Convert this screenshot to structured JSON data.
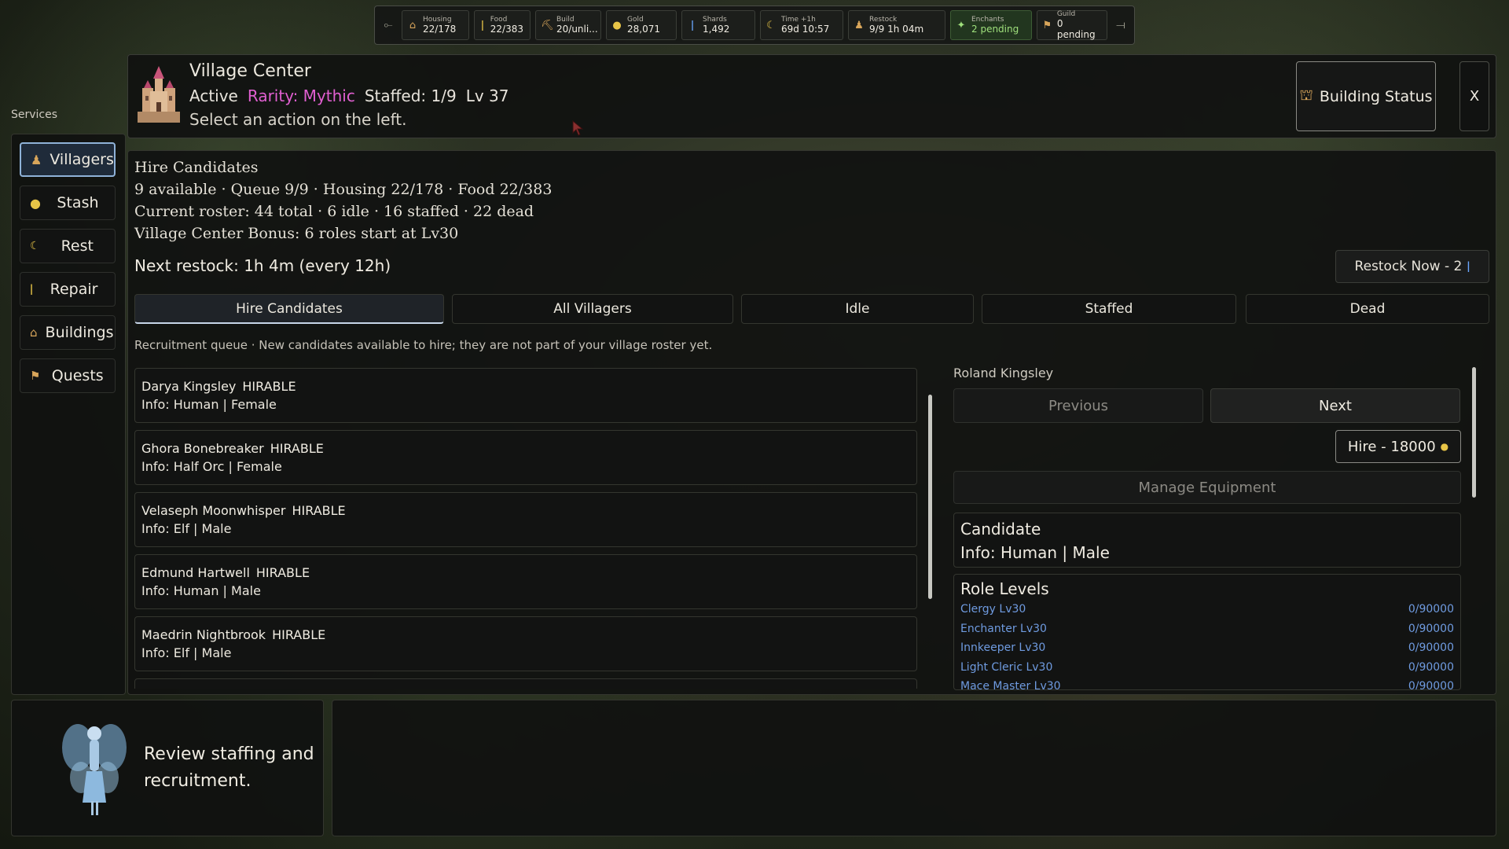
{
  "resources": [
    {
      "label": "Housing",
      "value": "22/178",
      "icon": "housing-icon"
    },
    {
      "label": "Food",
      "value": "22/383",
      "icon": "food-icon"
    },
    {
      "label": "Build",
      "value": "20/unli...",
      "icon": "build-icon"
    },
    {
      "label": "Gold",
      "value": "28,071",
      "icon": "gold-coin-icon"
    },
    {
      "label": "Shards",
      "value": "1,492",
      "icon": "shard-icon"
    },
    {
      "label": "Time +1h",
      "value": "69d 10:57",
      "icon": "moon-icon"
    },
    {
      "label": "Restock",
      "value": "9/9 1h 04m",
      "icon": "restock-icon"
    },
    {
      "label": "Enchants",
      "value": "2 pending",
      "icon": "enchant-icon"
    },
    {
      "label": "Guild",
      "value": "0 pending",
      "icon": "guild-icon"
    }
  ],
  "header": {
    "title": "Village Center",
    "status": "Active",
    "rarity": "Rarity: Mythic",
    "staffed": "Staffed: 1/9",
    "level": "Lv 37",
    "subtitle": "Select an action on the left.",
    "building_status_label": "Building Status",
    "close_label": "X"
  },
  "sidebar": {
    "section_label": "Services",
    "items": [
      {
        "label": "Villagers",
        "icon": "villager-icon",
        "active": true
      },
      {
        "label": "Stash",
        "icon": "stash-icon",
        "active": false
      },
      {
        "label": "Rest",
        "icon": "moon-icon",
        "active": false
      },
      {
        "label": "Repair",
        "icon": "repair-icon",
        "active": false
      },
      {
        "label": "Buildings",
        "icon": "buildings-icon",
        "active": false
      },
      {
        "label": "Quests",
        "icon": "quests-icon",
        "active": false
      }
    ]
  },
  "main": {
    "title": "Hire Candidates",
    "summary_1": "9 available  ·  Queue 9/9  ·  Housing 22/178  ·  Food 22/383",
    "summary_2": "Current roster: 44 total  ·  6 idle  ·  16 staffed  ·  22 dead",
    "summary_3": "Village Center Bonus: 6 roles start at Lv30",
    "next_restock": "Next restock: 1h 4m (every 12h)",
    "restock_button": "Restock Now -  2",
    "tabs": [
      "Hire Candidates",
      "All Villagers",
      "Idle",
      "Staffed",
      "Dead"
    ],
    "active_tab": "Hire Candidates",
    "queue_note": "Recruitment queue · New candidates available to hire; they are not part of your village roster yet.",
    "candidates": [
      {
        "name": "Darya Kingsley",
        "status": "HIRABLE",
        "info": "Info: Human | Female"
      },
      {
        "name": "Ghora Bonebreaker",
        "status": "HIRABLE",
        "info": "Info: Half Orc | Female"
      },
      {
        "name": "Velaseph Moonwhisper",
        "status": "HIRABLE",
        "info": "Info: Elf | Male"
      },
      {
        "name": "Edmund Hartwell",
        "status": "HIRABLE",
        "info": "Info: Human | Male"
      },
      {
        "name": "Maedrin Nightbrook",
        "status": "HIRABLE",
        "info": "Info: Elf | Male"
      }
    ]
  },
  "detail": {
    "name": "Roland Kingsley",
    "previous_label": "Previous",
    "next_label": "Next",
    "hire_label": "Hire -  18000",
    "manage_equipment_label": "Manage Equipment",
    "candidate_title": "Candidate",
    "candidate_info": "Info: Human | Male",
    "roles_title": "Role Levels",
    "roles": [
      {
        "name": "Clergy Lv30",
        "xp": "0/90000"
      },
      {
        "name": "Enchanter Lv30",
        "xp": "0/90000"
      },
      {
        "name": "Innkeeper Lv30",
        "xp": "0/90000"
      },
      {
        "name": "Light Cleric Lv30",
        "xp": "0/90000"
      },
      {
        "name": "Mace Master Lv30",
        "xp": "0/90000"
      }
    ]
  },
  "tip": {
    "text": "Review staffing and recruitment."
  },
  "colors": {
    "mythic": "#e05fd0",
    "role_link": "#6f9be0",
    "active_tab_accent": "#8fb2d8",
    "gold": "#e8c547"
  }
}
